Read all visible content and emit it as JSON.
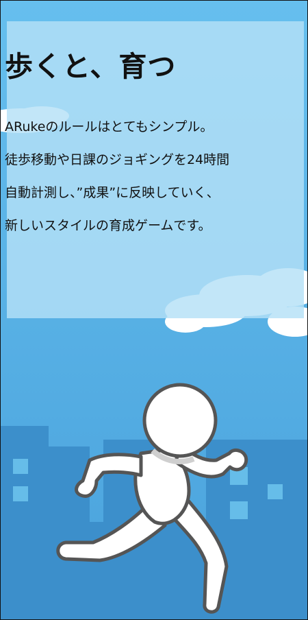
{
  "section": {
    "headline": "歩くと、育つ",
    "body": [
      "ARukeのルールはとてもシンプル。",
      "徒歩移動や日課のジョギングを24時間",
      "自動計測し、”成果”に反映していく、",
      "新しいスタイルの育成ゲームです。"
    ]
  },
  "illustration": {
    "subject": "running-person",
    "colors": {
      "sky": "#5ab6e8",
      "sky_light": "#b4e0f6",
      "buildings": "#3a8cc8",
      "cloud": "#ffffff",
      "figure": "#ffffff",
      "outline": "#555555"
    }
  }
}
